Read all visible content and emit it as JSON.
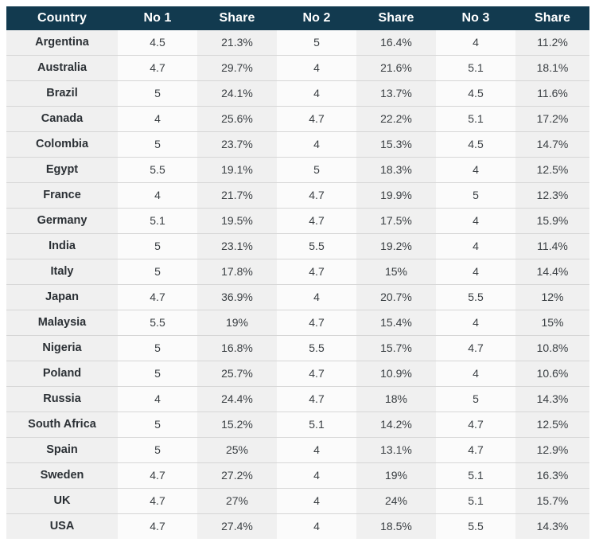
{
  "table": {
    "columns": [
      {
        "label": "Country",
        "key": "country",
        "kind": "label",
        "shaded": true
      },
      {
        "label": "No 1",
        "key": "no1",
        "kind": "number",
        "shaded": false
      },
      {
        "label": "Share",
        "key": "share1",
        "kind": "number",
        "shaded": true
      },
      {
        "label": "No 2",
        "key": "no2",
        "kind": "number",
        "shaded": false
      },
      {
        "label": "Share",
        "key": "share2",
        "kind": "number",
        "shaded": true
      },
      {
        "label": "No 3",
        "key": "no3",
        "kind": "number",
        "shaded": false
      },
      {
        "label": "Share",
        "key": "share3",
        "kind": "number",
        "shaded": true
      }
    ],
    "rows": [
      {
        "country": "Argentina",
        "no1": "4.5",
        "share1": "21.3%",
        "no2": "5",
        "share2": "16.4%",
        "no3": "4",
        "share3": "11.2%"
      },
      {
        "country": "Australia",
        "no1": "4.7",
        "share1": "29.7%",
        "no2": "4",
        "share2": "21.6%",
        "no3": "5.1",
        "share3": "18.1%"
      },
      {
        "country": "Brazil",
        "no1": "5",
        "share1": "24.1%",
        "no2": "4",
        "share2": "13.7%",
        "no3": "4.5",
        "share3": "11.6%"
      },
      {
        "country": "Canada",
        "no1": "4",
        "share1": "25.6%",
        "no2": "4.7",
        "share2": "22.2%",
        "no3": "5.1",
        "share3": "17.2%"
      },
      {
        "country": "Colombia",
        "no1": "5",
        "share1": "23.7%",
        "no2": "4",
        "share2": "15.3%",
        "no3": "4.5",
        "share3": "14.7%"
      },
      {
        "country": "Egypt",
        "no1": "5.5",
        "share1": "19.1%",
        "no2": "5",
        "share2": "18.3%",
        "no3": "4",
        "share3": "12.5%"
      },
      {
        "country": "France",
        "no1": "4",
        "share1": "21.7%",
        "no2": "4.7",
        "share2": "19.9%",
        "no3": "5",
        "share3": "12.3%"
      },
      {
        "country": "Germany",
        "no1": "5.1",
        "share1": "19.5%",
        "no2": "4.7",
        "share2": "17.5%",
        "no3": "4",
        "share3": "15.9%"
      },
      {
        "country": "India",
        "no1": "5",
        "share1": "23.1%",
        "no2": "5.5",
        "share2": "19.2%",
        "no3": "4",
        "share3": "11.4%"
      },
      {
        "country": "Italy",
        "no1": "5",
        "share1": "17.8%",
        "no2": "4.7",
        "share2": "15%",
        "no3": "4",
        "share3": "14.4%"
      },
      {
        "country": "Japan",
        "no1": "4.7",
        "share1": "36.9%",
        "no2": "4",
        "share2": "20.7%",
        "no3": "5.5",
        "share3": "12%"
      },
      {
        "country": "Malaysia",
        "no1": "5.5",
        "share1": "19%",
        "no2": "4.7",
        "share2": "15.4%",
        "no3": "4",
        "share3": "15%"
      },
      {
        "country": "Nigeria",
        "no1": "5",
        "share1": "16.8%",
        "no2": "5.5",
        "share2": "15.7%",
        "no3": "4.7",
        "share3": "10.8%"
      },
      {
        "country": "Poland",
        "no1": "5",
        "share1": "25.7%",
        "no2": "4.7",
        "share2": "10.9%",
        "no3": "4",
        "share3": "10.6%"
      },
      {
        "country": "Russia",
        "no1": "4",
        "share1": "24.4%",
        "no2": "4.7",
        "share2": "18%",
        "no3": "5",
        "share3": "14.3%"
      },
      {
        "country": "South Africa",
        "no1": "5",
        "share1": "15.2%",
        "no2": "5.1",
        "share2": "14.2%",
        "no3": "4.7",
        "share3": "12.5%"
      },
      {
        "country": "Spain",
        "no1": "5",
        "share1": "25%",
        "no2": "4",
        "share2": "13.1%",
        "no3": "4.7",
        "share3": "12.9%"
      },
      {
        "country": "Sweden",
        "no1": "4.7",
        "share1": "27.2%",
        "no2": "4",
        "share2": "19%",
        "no3": "5.1",
        "share3": "16.3%"
      },
      {
        "country": "UK",
        "no1": "4.7",
        "share1": "27%",
        "no2": "4",
        "share2": "24%",
        "no3": "5.1",
        "share3": "15.7%"
      },
      {
        "country": "USA",
        "no1": "4.7",
        "share1": "27.4%",
        "no2": "4",
        "share2": "18.5%",
        "no3": "5.5",
        "share3": "14.3%"
      }
    ]
  },
  "chart_data": {
    "type": "table",
    "title": "",
    "columns": [
      "Country",
      "No 1",
      "Share",
      "No 2",
      "Share",
      "No 3",
      "Share"
    ],
    "rows": [
      [
        "Argentina",
        "4.5",
        "21.3%",
        "5",
        "16.4%",
        "4",
        "11.2%"
      ],
      [
        "Australia",
        "4.7",
        "29.7%",
        "4",
        "21.6%",
        "5.1",
        "18.1%"
      ],
      [
        "Brazil",
        "5",
        "24.1%",
        "4",
        "13.7%",
        "4.5",
        "11.6%"
      ],
      [
        "Canada",
        "4",
        "25.6%",
        "4.7",
        "22.2%",
        "5.1",
        "17.2%"
      ],
      [
        "Colombia",
        "5",
        "23.7%",
        "4",
        "15.3%",
        "4.5",
        "14.7%"
      ],
      [
        "Egypt",
        "5.5",
        "19.1%",
        "5",
        "18.3%",
        "4",
        "12.5%"
      ],
      [
        "France",
        "4",
        "21.7%",
        "4.7",
        "19.9%",
        "5",
        "12.3%"
      ],
      [
        "Germany",
        "5.1",
        "19.5%",
        "4.7",
        "17.5%",
        "4",
        "15.9%"
      ],
      [
        "India",
        "5",
        "23.1%",
        "5.5",
        "19.2%",
        "4",
        "11.4%"
      ],
      [
        "Italy",
        "5",
        "17.8%",
        "4.7",
        "15%",
        "4",
        "14.4%"
      ],
      [
        "Japan",
        "4.7",
        "36.9%",
        "4",
        "20.7%",
        "5.5",
        "12%"
      ],
      [
        "Malaysia",
        "5.5",
        "19%",
        "4.7",
        "15.4%",
        "4",
        "15%"
      ],
      [
        "Nigeria",
        "5",
        "16.8%",
        "5.5",
        "15.7%",
        "4.7",
        "10.8%"
      ],
      [
        "Poland",
        "5",
        "25.7%",
        "4.7",
        "10.9%",
        "4",
        "10.6%"
      ],
      [
        "Russia",
        "4",
        "24.4%",
        "4.7",
        "18%",
        "5",
        "14.3%"
      ],
      [
        "South Africa",
        "5",
        "15.2%",
        "5.1",
        "14.2%",
        "4.7",
        "12.5%"
      ],
      [
        "Spain",
        "5",
        "25%",
        "4",
        "13.1%",
        "4.7",
        "12.9%"
      ],
      [
        "Sweden",
        "4.7",
        "27.2%",
        "4",
        "19%",
        "5.1",
        "16.3%"
      ],
      [
        "UK",
        "4.7",
        "27%",
        "4",
        "24%",
        "5.1",
        "15.7%"
      ],
      [
        "USA",
        "4.7",
        "27.4%",
        "4",
        "18.5%",
        "5.5",
        "14.3%"
      ]
    ]
  },
  "colors": {
    "header_background": "#123a4f",
    "header_text": "#ffffff",
    "cell_shaded": "#f0f0f0",
    "cell_plain": "#fbfbfb",
    "row_divider": "#d6d6d6",
    "body_text": "#3a3f43",
    "country_text": "#2b3035"
  }
}
